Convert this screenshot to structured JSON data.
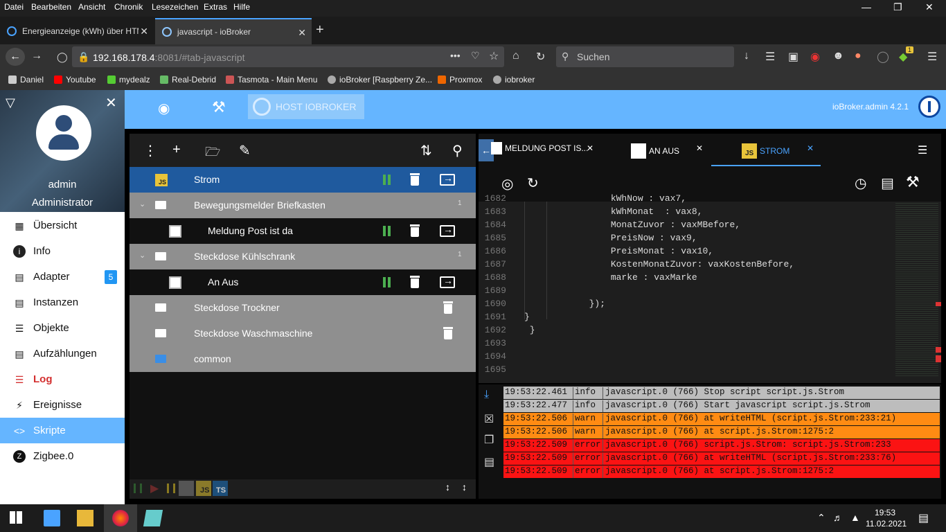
{
  "browser": {
    "menu": [
      "Datei",
      "Bearbeiten",
      "Ansicht",
      "Chronik",
      "Lesezeichen",
      "Extras",
      "Hilfe"
    ],
    "tabs": [
      {
        "title": "Energieanzeige (kWh) über HTM"
      },
      {
        "title": "javascript - ioBroker"
      }
    ],
    "url_host": "192.168.178.4",
    "url_rest": ":8081/#tab-javascript",
    "search_placeholder": "Suchen",
    "bookmarks": [
      "Daniel",
      "Youtube",
      "mydealz",
      "Real-Debrid",
      "Tasmota - Main Menu",
      "ioBroker [Raspberry Ze...",
      "Proxmox",
      "iobroker"
    ],
    "extension_badge": "1"
  },
  "header": {
    "host_label": "HOST IOBROKER",
    "admin_version": "ioBroker.admin 4.2.1"
  },
  "sidebar": {
    "user_name": "admin",
    "user_role": "Administrator",
    "items": [
      {
        "label": "Übersicht"
      },
      {
        "label": "Info"
      },
      {
        "label": "Adapter",
        "badge": "5"
      },
      {
        "label": "Instanzen"
      },
      {
        "label": "Objekte"
      },
      {
        "label": "Aufzählungen"
      },
      {
        "label": "Log"
      },
      {
        "label": "Ereignisse"
      },
      {
        "label": "Skripte"
      },
      {
        "label": "Zigbee.0"
      }
    ]
  },
  "tree": {
    "rows": [
      {
        "label": "Strom",
        "icon": "JS"
      },
      {
        "label": "Bewegungsmelder Briefkasten",
        "count": "1"
      },
      {
        "label": "Meldung Post ist da"
      },
      {
        "label": "Steckdose Kühlschrank",
        "count": "1"
      },
      {
        "label": "An Aus"
      },
      {
        "label": "Steckdose Trockner"
      },
      {
        "label": "Steckdose Waschmaschine"
      },
      {
        "label": "common"
      }
    ],
    "bottom_js": "JS",
    "bottom_ts": "TS"
  },
  "editor": {
    "tabs": [
      {
        "label": "MELDUNG POST IS..."
      },
      {
        "label": "AN AUS"
      },
      {
        "label": "STROM",
        "icon": "JS"
      }
    ],
    "lines": [
      {
        "n": "1682",
        "t": "                kWhNow : vax7,"
      },
      {
        "n": "1683",
        "t": "                kWhMonat  : vax8,"
      },
      {
        "n": "1684",
        "t": "                MonatZuvor : vaxMBefore,"
      },
      {
        "n": "1685",
        "t": "                PreisNow : vax9,"
      },
      {
        "n": "1686",
        "t": "                PreisMonat : vax10,"
      },
      {
        "n": "1687",
        "t": "                KostenMonatZuvor: vaxKostenBefore,"
      },
      {
        "n": "1688",
        "t": "                marke : vaxMarke"
      },
      {
        "n": "1689",
        "t": ""
      },
      {
        "n": "1690",
        "t": "            });"
      },
      {
        "n": "1691",
        "t": "}"
      },
      {
        "n": "1692",
        "t": " }"
      },
      {
        "n": "1693",
        "t": ""
      },
      {
        "n": "1694",
        "t": ""
      },
      {
        "n": "1695",
        "t": ""
      }
    ]
  },
  "log": [
    {
      "time": "19:53:22.461",
      "level": "info",
      "msg": "javascript.0 (766) Stop script script.js.Strom"
    },
    {
      "time": "19:53:22.477",
      "level": "info",
      "msg": "javascript.0 (766) Start javascript script.js.Strom"
    },
    {
      "time": "19:53:22.506",
      "level": "warn",
      "msg": "javascript.0 (766) at writeHTML (script.js.Strom:233:21)"
    },
    {
      "time": "19:53:22.506",
      "level": "warn",
      "msg": "javascript.0 (766) at script.js.Strom:1275:2"
    },
    {
      "time": "19:53:22.509",
      "level": "error",
      "msg": "javascript.0 (766) script.js.Strom: script.js.Strom:233"
    },
    {
      "time": "19:53:22.509",
      "level": "error",
      "msg": "javascript.0 (766) at writeHTML (script.js.Strom:233:76)"
    },
    {
      "time": "19:53:22.509",
      "level": "error",
      "msg": "javascript.0 (766) at script.js.Strom:1275:2"
    }
  ],
  "taskbar": {
    "time": "19:53",
    "date": "11.02.2021"
  },
  "colors": {
    "accent": "#65b5ff",
    "selected_row": "#1f5a9e",
    "folder_row": "#8f8f8f",
    "warn": "#ff8b13",
    "error": "#fb1313",
    "info": "#bdbdbd"
  }
}
